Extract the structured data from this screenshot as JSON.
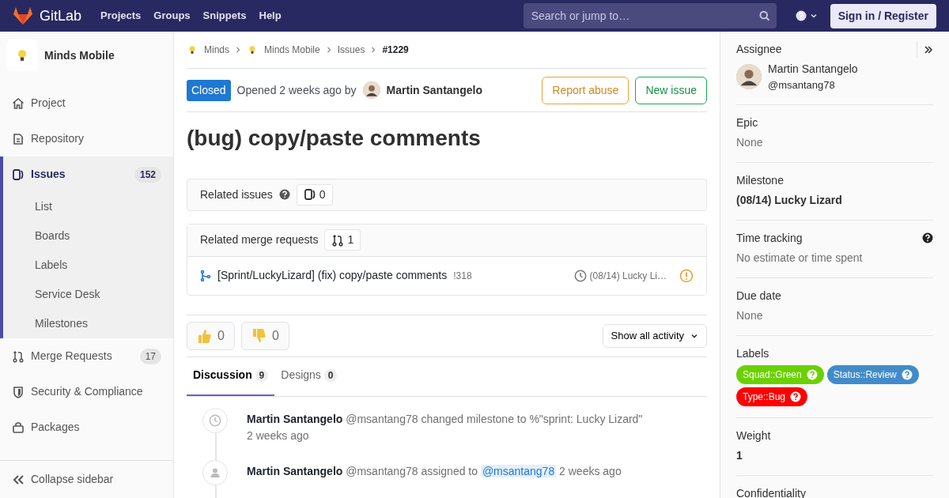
{
  "navbar": {
    "brand": "GitLab",
    "links": [
      "Projects",
      "Groups",
      "Snippets",
      "Help"
    ],
    "search": {
      "placeholder": "Search or jump to…"
    },
    "sign_in": "Sign in / Register"
  },
  "sidebar": {
    "project": "Minds Mobile",
    "items": [
      {
        "label": "Project",
        "selected": false
      },
      {
        "label": "Repository",
        "selected": false
      },
      {
        "label": "Issues",
        "selected": true,
        "count": "152",
        "children": [
          {
            "label": "List"
          },
          {
            "label": "Boards"
          },
          {
            "label": "Labels"
          },
          {
            "label": "Service Desk"
          },
          {
            "label": "Milestones"
          }
        ]
      },
      {
        "label": "Merge Requests",
        "selected": false,
        "count": "17"
      },
      {
        "label": "Security & Compliance",
        "selected": false
      },
      {
        "label": "Packages",
        "selected": false
      }
    ],
    "collapse": "Collapse sidebar"
  },
  "breadcrumbs": [
    "Minds",
    "Minds Mobile",
    "Issues",
    "#1229"
  ],
  "issue": {
    "status": "Closed",
    "opened": "Opened 2 weeks ago by",
    "author": "Martin Santangelo",
    "buttons": [
      "Report abuse",
      "New issue"
    ],
    "title": "(bug) copy/paste comments"
  },
  "related_issues": {
    "title": "Related issues",
    "count": "0"
  },
  "related_mrs": {
    "title": "Related merge requests",
    "count": "1",
    "items": [
      {
        "title": "[Sprint/LuckyLizard] (fix) copy/paste comments",
        "ref": "!318",
        "milestone": "(08/14) Lucky Li…"
      }
    ]
  },
  "awards": [
    {
      "count": "0"
    },
    {
      "count": "0"
    }
  ],
  "activity_filter": "Show all activity",
  "tabs": [
    {
      "label": "Discussion",
      "count": "9",
      "selected": true
    },
    {
      "label": "Designs",
      "count": "0",
      "selected": false
    }
  ],
  "notes": [
    {
      "kind": "milestone",
      "author": "Martin Santangelo",
      "text": "@msantang78 changed milestone to %\"sprint: Lucky Lizard\"",
      "time": "2 weeks ago"
    },
    {
      "kind": "assign",
      "author": "Martin Santangelo",
      "text": "@msantang78 assigned to",
      "mention": "@msantang78",
      "time": "2 weeks ago"
    }
  ],
  "right_sidebar": {
    "assignee": {
      "title": "Assignee",
      "name": "Martin Santangelo",
      "username": "@msantang78"
    },
    "blocks": [
      {
        "title": "Epic",
        "value": "None",
        "kind": "muted"
      },
      {
        "title": "Milestone",
        "value": "(08/14) Lucky Lizard",
        "kind": "bold"
      },
      {
        "title": "Time tracking",
        "value": "No estimate or time spent",
        "kind": "muted",
        "help": true
      },
      {
        "title": "Due date",
        "value": "None",
        "kind": "muted"
      }
    ],
    "labels": {
      "title": "Labels",
      "items": [
        {
          "text": "Squad::Green",
          "color": "#69d100"
        },
        {
          "text": "Status::Review",
          "color": "#428bca"
        },
        {
          "text": "Type::Bug",
          "color": "#ff0000"
        }
      ]
    },
    "weight": {
      "title": "Weight",
      "value": "1"
    },
    "confidentiality": {
      "title": "Confidentiality"
    }
  }
}
